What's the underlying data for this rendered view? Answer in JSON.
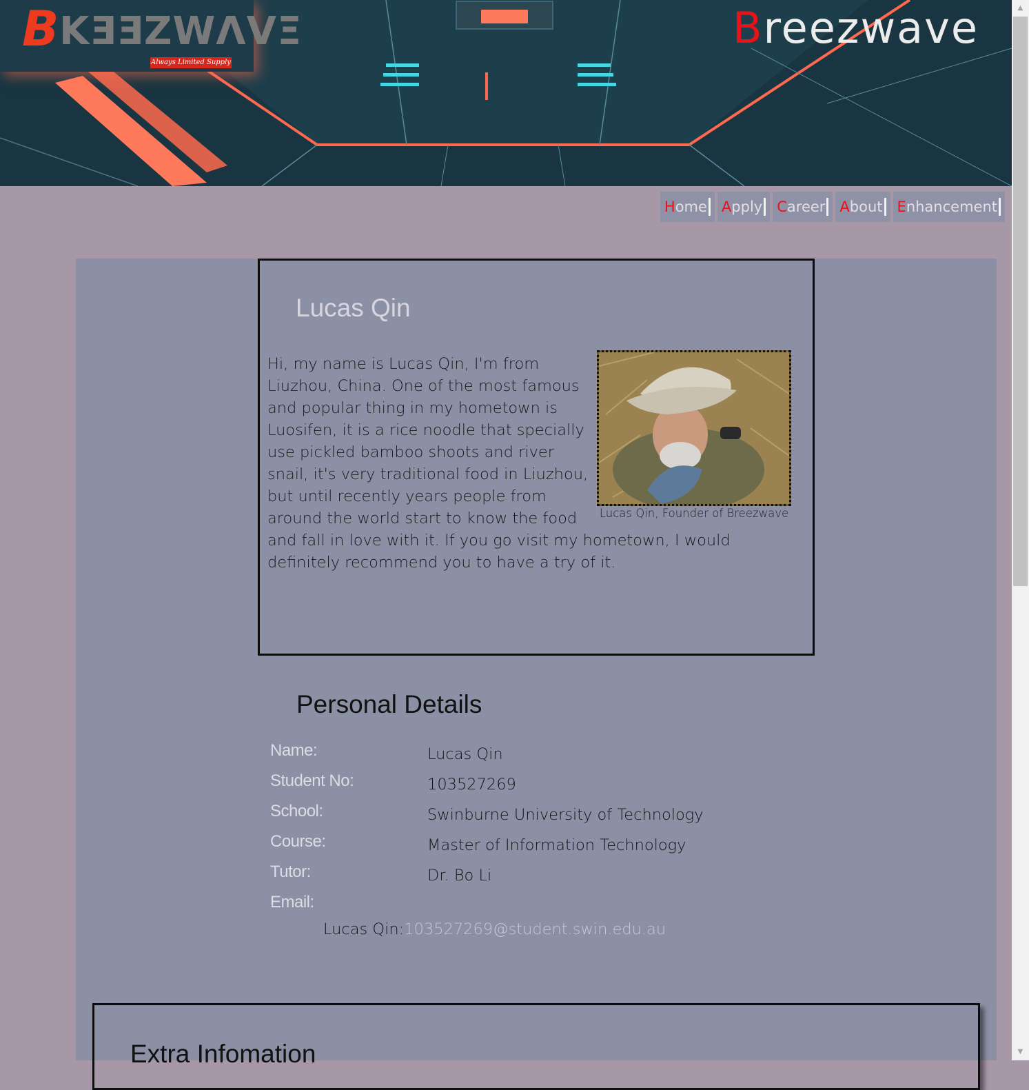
{
  "header": {
    "logo_mark": "B",
    "logo_text": "KƎƎZWΛVΞ",
    "logo_tagline": "Always Limited Supply",
    "site_title_first": "B",
    "site_title_rest": "reezwave"
  },
  "nav": {
    "items": [
      {
        "cap": "H",
        "rest": "ome"
      },
      {
        "cap": "A",
        "rest": "pply"
      },
      {
        "cap": "C",
        "rest": "areer"
      },
      {
        "cap": "A",
        "rest": "bout"
      },
      {
        "cap": "E",
        "rest": "nhancement"
      }
    ]
  },
  "intro": {
    "name": "Lucas Qin",
    "text": "Hi, my name is Lucas Qin, I'm from Liuzhou, China. One of the most famous and popular thing in my hometown is Luosifen, it is a rice noodle that specially use pickled bamboo shoots and river snail, it's very traditional food in Liuzhou, but until recently years people from around the world start to know the food and fall in love with it. If you go visit my hometown, I would definitely recommend you to have a try of it.",
    "photo_caption": "Lucas Qin, Founder of Breezwave"
  },
  "personal_details": {
    "title": "Personal Details",
    "rows": [
      {
        "label": "Name:",
        "value": "Lucas Qin"
      },
      {
        "label": "Student No:",
        "value": "103527269"
      },
      {
        "label": "School:",
        "value": "Swinburne University of Technology"
      },
      {
        "label": "Course:",
        "value": "Master of Information Technology"
      },
      {
        "label": "Tutor:",
        "value": "Dr. Bo Li"
      },
      {
        "label": "Email:",
        "value": ""
      }
    ],
    "email_prefix": "Lucas Qin:",
    "email_address": "103527269@student.swin.edu.au"
  },
  "extra": {
    "title": "Extra Infomation"
  },
  "colors": {
    "accent": "#e8121a",
    "page_bg": "#a798a8",
    "panel_bg": "#8b90a4"
  }
}
